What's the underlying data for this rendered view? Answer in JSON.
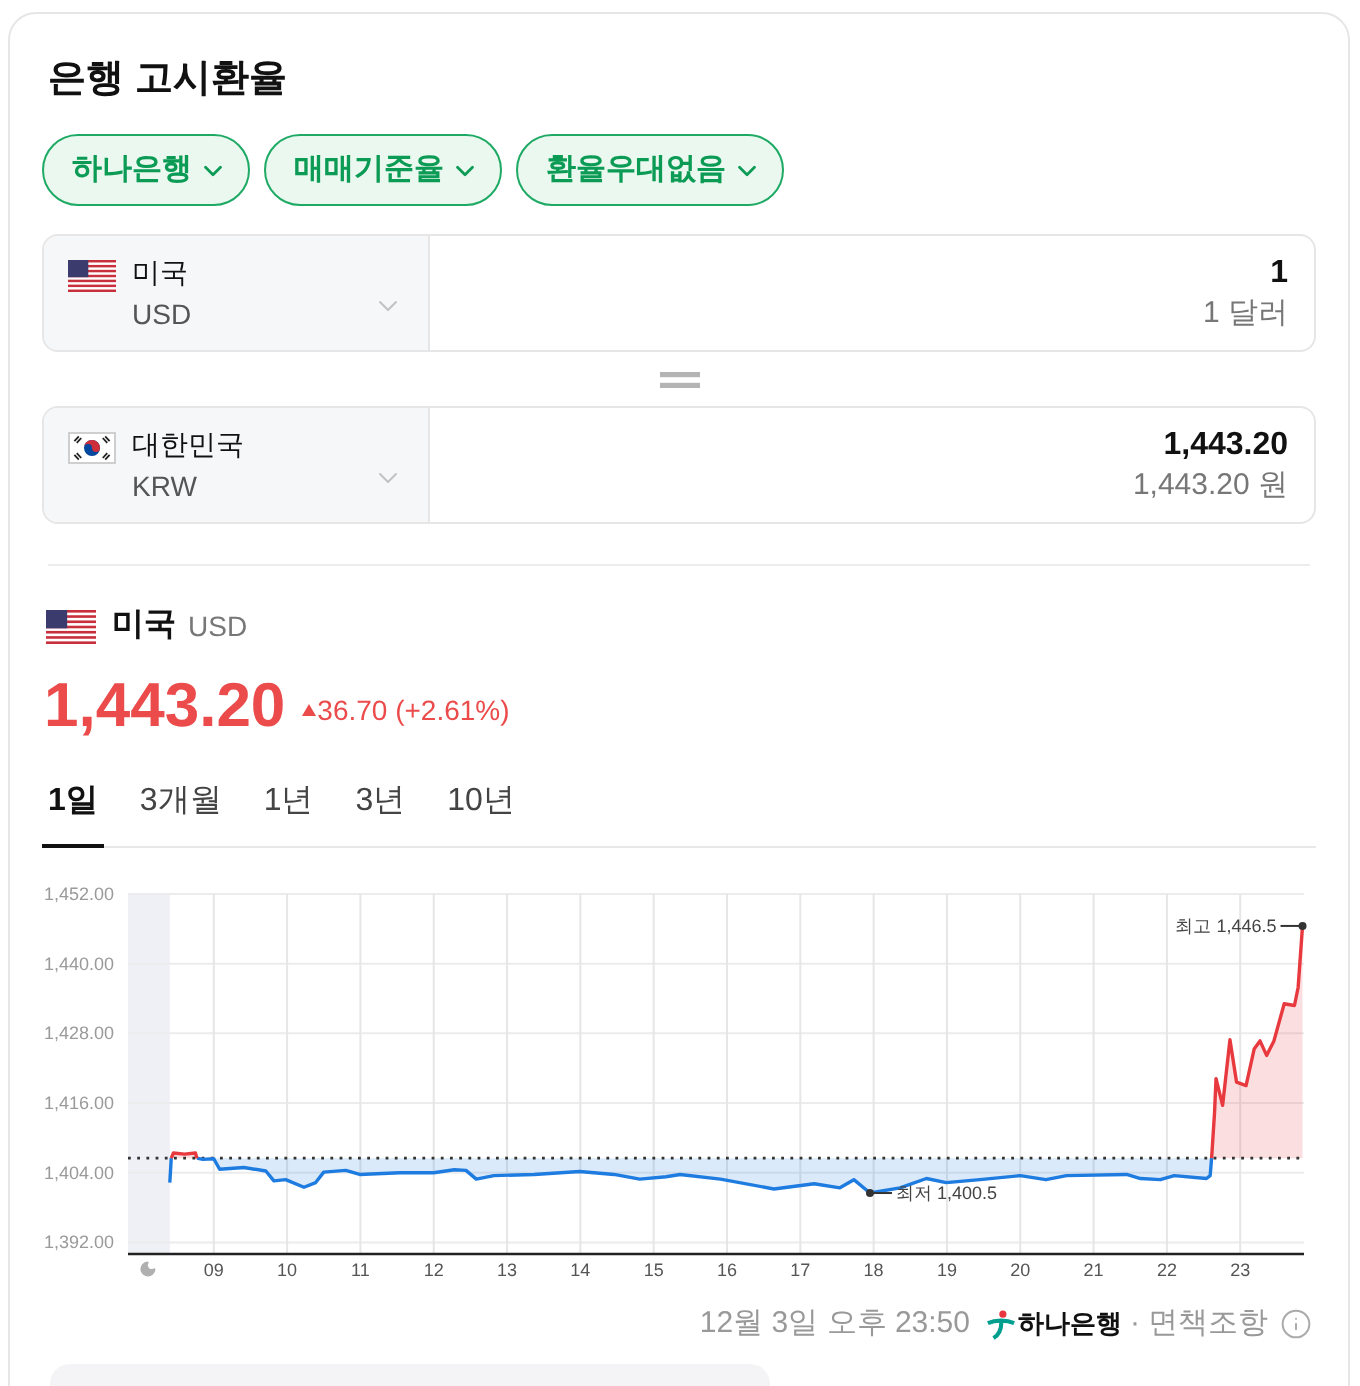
{
  "title": "은행 고시환율",
  "filters": [
    {
      "label": "하나은행"
    },
    {
      "label": "매매기준율"
    },
    {
      "label": "환율우대없음"
    }
  ],
  "converter": [
    {
      "kind": "us",
      "country": "미국",
      "code": "USD",
      "amount": "1",
      "amount_text": "1 달러"
    },
    {
      "kind": "kr",
      "country": "대한민국",
      "code": "KRW",
      "amount": "1,443.20",
      "amount_text": "1,443.20 원"
    }
  ],
  "summary": {
    "kind": "us",
    "country": "미국",
    "code": "USD",
    "price": "1,443.20",
    "rising": true,
    "change": "36.70 (+2.61%)"
  },
  "periods": [
    {
      "label": "1일",
      "selected": true
    },
    {
      "label": "3개월",
      "selected": false
    },
    {
      "label": "1년",
      "selected": false
    },
    {
      "label": "3년",
      "selected": false
    },
    {
      "label": "10년",
      "selected": false
    }
  ],
  "chart": {
    "chart_data": {
      "type": "area",
      "grid": true,
      "x": [
        8.4,
        8.42,
        8.45,
        8.6,
        8.75,
        8.77,
        8.85,
        9,
        9.08,
        9.41,
        9.71,
        9.82,
        9.98,
        10.23,
        10.39,
        10.5,
        10.8,
        10.99,
        11.54,
        12,
        12.28,
        12.44,
        12.58,
        12.82,
        13.37,
        13.99,
        14.46,
        14.81,
        15.17,
        15.36,
        15.91,
        16.64,
        17.19,
        17.54,
        17.73,
        17.95,
        18.36,
        18.72,
        18.99,
        19.45,
        20,
        20.35,
        20.63,
        21.45,
        21.64,
        21.91,
        22.1,
        22.54,
        22.59,
        22.61,
        22.65,
        22.67,
        22.76,
        22.86,
        22.95,
        23.08,
        23.19,
        23.27,
        23.36,
        23.46,
        23.6,
        23.74,
        23.79,
        23.85
      ],
      "series": [
        {
          "color": "#1e7ce0",
          "values": [
            1402.3,
            1406.5,
            null,
            null,
            null,
            1406.5,
            1406.3,
            1406.4,
            1404.6,
            1404.9,
            1404.3,
            1402.6,
            1402.8,
            1401.5,
            1402.3,
            1404.1,
            1404.4,
            1403.7,
            1404.0,
            1404.0,
            1404.5,
            1404.4,
            1402.9,
            1403.5,
            1403.7,
            1404.2,
            1403.7,
            1402.9,
            1403.3,
            1403.7,
            1402.9,
            1401.2,
            1402.1,
            1401.4,
            1402.8,
            1400.5,
            1401.4,
            1403.0,
            1402.3,
            1402.8,
            1403.5,
            1402.8,
            1403.5,
            1403.7,
            1403.0,
            1402.8,
            1403.5,
            1403.0,
            1403.5,
            1406.5,
            null,
            null,
            null,
            null,
            null,
            null,
            null,
            null,
            null,
            null,
            null,
            null,
            null,
            null
          ]
        },
        {
          "color": "#e8393f",
          "values": [
            null,
            1406.5,
            1407.4,
            1407.2,
            1407.4,
            1406.5,
            null,
            null,
            null,
            null,
            null,
            null,
            null,
            null,
            null,
            null,
            null,
            null,
            null,
            null,
            null,
            null,
            null,
            null,
            null,
            null,
            null,
            null,
            null,
            null,
            null,
            null,
            null,
            null,
            null,
            null,
            null,
            null,
            null,
            null,
            null,
            null,
            null,
            null,
            null,
            null,
            null,
            null,
            null,
            1406.5,
            1414.4,
            1420.2,
            1415.6,
            1426.9,
            1419.6,
            1419.0,
            1425.3,
            1426.7,
            1424.2,
            1426.7,
            1433.1,
            1432.8,
            1435.9,
            1446.5
          ]
        }
      ],
      "xlim": [
        7.83,
        23.87
      ],
      "ylim": [
        1390,
        1452
      ],
      "xticks": [
        {
          "value": 9,
          "label": "09"
        },
        {
          "value": 10,
          "label": "10"
        },
        {
          "value": 11,
          "label": "11"
        },
        {
          "value": 12,
          "label": "12"
        },
        {
          "value": 13,
          "label": "13"
        },
        {
          "value": 14,
          "label": "14"
        },
        {
          "value": 15,
          "label": "15"
        },
        {
          "value": 16,
          "label": "16"
        },
        {
          "value": 17,
          "label": "17"
        },
        {
          "value": 18,
          "label": "18"
        },
        {
          "value": 19,
          "label": "19"
        },
        {
          "value": 20,
          "label": "20"
        },
        {
          "value": 21,
          "label": "21"
        },
        {
          "value": 22,
          "label": "22"
        },
        {
          "value": 23,
          "label": "23"
        }
      ],
      "yticks": [
        {
          "value": 1392,
          "label": "1,392.00"
        },
        {
          "value": 1404,
          "label": "1,404.00"
        },
        {
          "value": 1416,
          "label": "1,416.00"
        },
        {
          "value": 1428,
          "label": "1,428.00"
        },
        {
          "value": 1440,
          "label": "1,440.00"
        },
        {
          "value": 1452,
          "label": "1,452.00"
        }
      ],
      "ref_lines": [
        {
          "axis": "y",
          "value": 1406.5
        }
      ],
      "bands": [
        {
          "axis": "x",
          "from": 7.83,
          "to": 8.4
        }
      ],
      "annotations": [
        {
          "x": 23.85,
          "y": 1446.5,
          "text": "최고 1,446.5"
        },
        {
          "x": 17.95,
          "y": 1400.5,
          "text": "최저 1,400.5"
        }
      ]
    }
  },
  "footer": {
    "timestamp": "12월 3일 오후 23:50",
    "bank": "하나은행",
    "separator": "·",
    "disclaimer": "면책조항"
  }
}
